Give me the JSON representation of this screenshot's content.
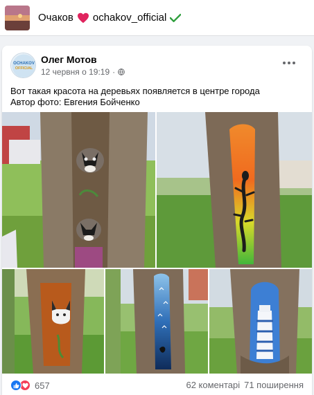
{
  "topbar": {
    "city": "Очаков",
    "handle": "ochakov_official"
  },
  "post": {
    "author": "Олег Мотов",
    "avatar_text": "OCHAKOV OFFICIAL",
    "time": "12 червня о 19:19",
    "separator": "·",
    "text_line1": "Вот такая красота на деревьях появляется в центре города",
    "text_line2": "Автор фото: Евгения Бойченко"
  },
  "stats": {
    "reactions_count": "657",
    "comments": "62 коментарі",
    "shares": "71 поширення"
  },
  "colors": {
    "brand_blue": "#1877f2",
    "love_red": "#f33e58",
    "heart": "#e0245e",
    "check": "#2e9e3c"
  },
  "photos": [
    {
      "subject": "raccoons-painted-tree"
    },
    {
      "subject": "lizard-rainbow-tree"
    },
    {
      "subject": "cat-painted-tree"
    },
    {
      "subject": "night-sky-birds-tree"
    },
    {
      "subject": "lighthouse-tree"
    }
  ]
}
